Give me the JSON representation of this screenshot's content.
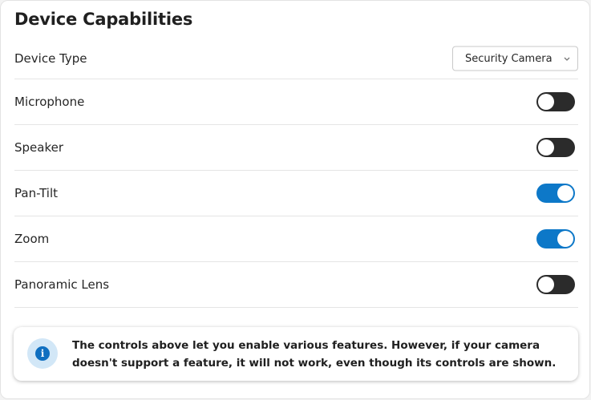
{
  "panel": {
    "title": "Device Capabilities"
  },
  "device_type": {
    "label": "Device Type",
    "selected": "Security Camera",
    "dropdown_icon": "chevron-down-icon"
  },
  "capabilities": [
    {
      "label": "Microphone",
      "enabled": false
    },
    {
      "label": "Speaker",
      "enabled": false
    },
    {
      "label": "Pan-Tilt",
      "enabled": true
    },
    {
      "label": "Zoom",
      "enabled": true
    },
    {
      "label": "Panoramic Lens",
      "enabled": false
    }
  ],
  "info": {
    "icon": "info-icon",
    "icon_glyph": "i",
    "text": "The controls above let you enable various features. However, if your camera doesn't support a feature, it will not work, even though its controls are shown."
  },
  "colors": {
    "toggle_on": "#0d78c8",
    "toggle_off": "#2b2b2b",
    "info_icon_bg": "#d2e7f7",
    "info_icon_fg": "#0f6fc0"
  }
}
